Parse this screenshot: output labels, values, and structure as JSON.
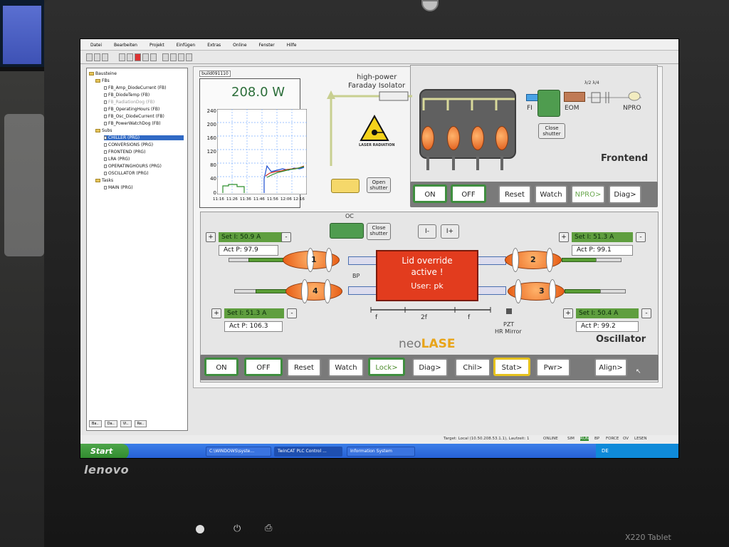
{
  "bezel": {
    "brand": "lenovo",
    "model": "X220 Tablet"
  },
  "window": {
    "menu": [
      "Datei",
      "Bearbeiten",
      "Projekt",
      "Einfügen",
      "Extras",
      "Online",
      "Fenster",
      "Hilfe"
    ]
  },
  "tree": {
    "root": "Bausteine",
    "fbs_label": "FBs",
    "fbs": [
      "FB_Amp_DiodeCurrent (FB)",
      "FB_DiodeTemp (FB)",
      "FB_RadiationDog (FB)",
      "FB_OperatingHours (FB)",
      "FB_Osc_DiodeCurrent (FB)",
      "FB_PowerWatchDog (FB)"
    ],
    "subs_label": "Subs",
    "subs": [
      "CHILLER (PRG)",
      "CONVERSIONS (PRG)",
      "FRONTEND (PRG)",
      "LRA (PRG)",
      "OPERATINGHOURS (PRG)",
      "OSCILLATOR (PRG)"
    ],
    "tasks_label": "Tasks",
    "tasks": [
      "MAIN (PRG)"
    ],
    "bottom_tabs": [
      "Ba..",
      "Da..",
      "Vi..",
      "Re.."
    ]
  },
  "graph": {
    "tab": "build091110",
    "power": "208.0 W",
    "yticks": [
      "240",
      "200",
      "160",
      "120",
      "80",
      "40",
      "0"
    ],
    "xticks": [
      "11:16",
      "11:26",
      "11:36",
      "11:46",
      "11:56",
      "12:06",
      "12:16"
    ]
  },
  "frontend": {
    "isolator_label_1": "high-power",
    "isolator_label_2": "Faraday Isolator",
    "warning": "LASER RADIATION",
    "fi": "FI",
    "eom": "EOM",
    "npro": "NPRO",
    "waveplates": "λ/2 λ/4",
    "close_shutter": "Close shutter",
    "open_shutter": "Open shutter",
    "title": "Frontend",
    "buttons": [
      "ON",
      "OFF",
      "Reset",
      "Watch",
      "NPRO>",
      "Diag>"
    ]
  },
  "oscillator": {
    "oc": "OC",
    "close_shutter": "Close shutter",
    "i_minus": "I-",
    "i_plus": "I+",
    "bp": "BP",
    "lid": {
      "line1": "Lid override",
      "line2": "active !",
      "line3": "User: pk"
    },
    "scale": [
      "f",
      "2f",
      "f"
    ],
    "pzt": "PZT",
    "hr_mirror": "HR Mirror",
    "amps": [
      {
        "num": "1",
        "set": "Set I: 50.9 A",
        "act": "Act P: 97.9"
      },
      {
        "num": "2",
        "set": "Set I: 51.3 A",
        "act": "Act P: 99.1"
      },
      {
        "num": "3",
        "set": "Set I: 50.4 A",
        "act": "Act P: 99.2"
      },
      {
        "num": "4",
        "set": "Set I: 51.3 A",
        "act": "Act P: 106.3"
      }
    ],
    "brand_neo": "neo",
    "brand_lase": "LASE",
    "title": "Oscillator",
    "buttons": [
      "ON",
      "OFF",
      "Reset",
      "Watch",
      "Lock>",
      "Diag>",
      "Chil>",
      "Stat>",
      "Pwr>",
      "Align>"
    ]
  },
  "status": {
    "target": "Target: Local (10.50.208.53.1.1), Laufzeit: 1",
    "online": "ONLINE",
    "sim": "SIM",
    "run": "RUN",
    "bp": "BP",
    "force": "FORCE",
    "ov": "OV",
    "read": "LESEN"
  },
  "taskbar": {
    "start": "Start",
    "tasks": [
      "C:\\WINDOWS\\syste...",
      "TwinCAT PLC Control ...",
      "Information System"
    ],
    "tray": "DE"
  },
  "colors": {
    "accent_green": "#3f8e3f",
    "alarm_red": "#e23c1e",
    "plot_green": "#2c6e3a",
    "brand_orange": "#e8a419"
  }
}
